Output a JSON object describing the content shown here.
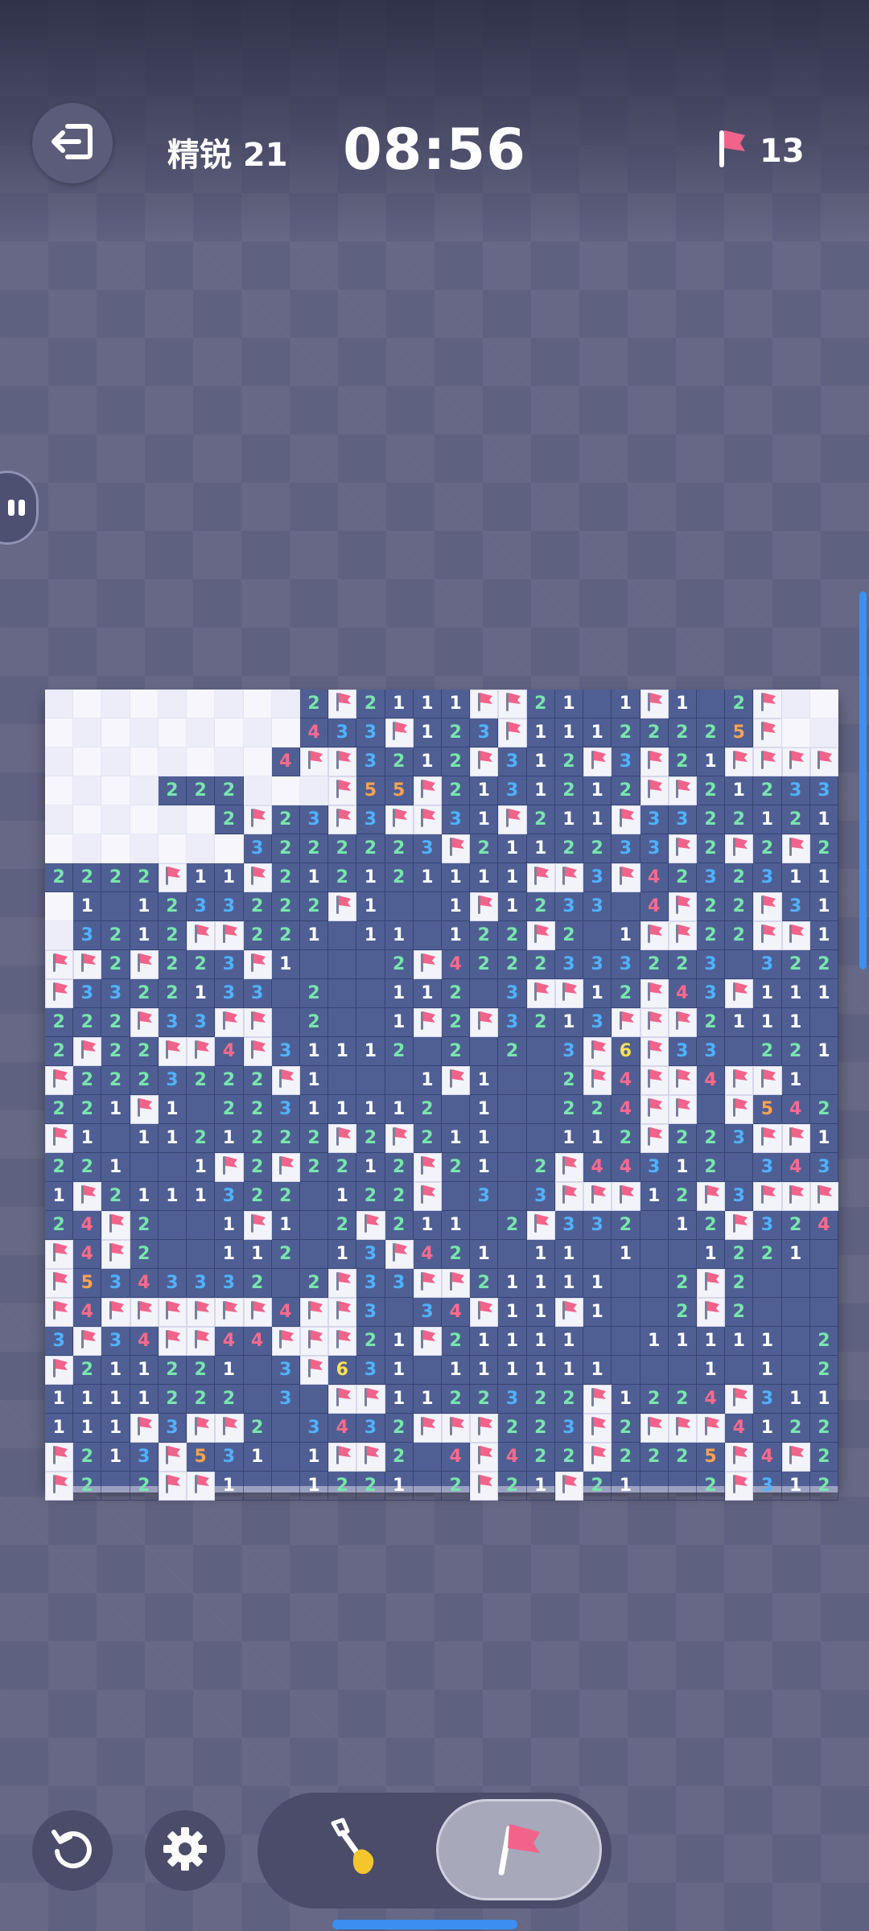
{
  "header": {
    "level": "精锐 21",
    "timer": "08:56",
    "flags_remaining": "13"
  },
  "mode": {
    "active": "flag"
  },
  "board": {
    "cols": 28,
    "rows": [
      "?????????2F2111FF21 1F1 2F??",
      "?????????433F123F11122225F??",
      "????????4FF3212F312F3F21FFFF",
      "????222???F55F2131212FF21233",
      "??????2F23F3FF31F211F33221215F",
      "???????3222223F2112233F2F2F221",
      "2222F11F212121111FF3F423231121",
      "?1 1233222F1  1F1233 4F22F311F",
      "?3212FF221 11 122F2 1FF22FF122",
      "FF2F223F1   2F4222333223 3222F",
      "F3322133 2  112 3FF12F43F111F13F",
      "222F33FF 2  1F2F3213FFF2111 23F",
      "2F22FF4F31112 2 2 3F6F33 221 1F3",
      "F2223222F1   1F1  2F4FF4FF1 12F",
      "221F1 22311112 1  224FF F542  22",
      "F1 1121222F2F211  112F223FF112F",
      "221  1F2F2212F21 2F44312 3434F3",
      "1F2111322 122F 3 3FFF12F3FFFF3",
      "24F2  1F1 2F211 2F332 12F3244F",
      "F4F2  112 13F421 11 1  1221 1F2",
      "F5343332 2F33FF21111  2F2   122",
      "F4FFFFFF4FF3 34F11F1  2F2   12F",
      "3F34FF44FFF21F21111  11111 2F2",
      "F211221 3F631 111111   1 1 2F211",
      "1111222 3 FF1122322F1224F311",
      "111F3FF2 3432FFF223F2FFF412222",
      "F213F531 1FF2 4F422F2225F4F2FF",
      "F2 2FF1  1221 2F21F21  2F3123F"
    ]
  },
  "colors": {
    "n1": "#ffffff",
    "n2": "#78e6ac",
    "n3": "#4fb2ff",
    "n4": "#ff6a8c",
    "n5": "#ffa250",
    "n6": "#ffe050",
    "flag": "#f2638a",
    "revealed": "#4f5f94",
    "hidden_a": "#ecedf8",
    "hidden_b": "#f6f6fc"
  },
  "icons": {
    "exit": "exit-icon",
    "flag_counter": "flag-icon",
    "restart": "restart-icon",
    "settings": "gear-icon",
    "dig": "shovel-icon",
    "flag_mode": "flag-icon"
  }
}
